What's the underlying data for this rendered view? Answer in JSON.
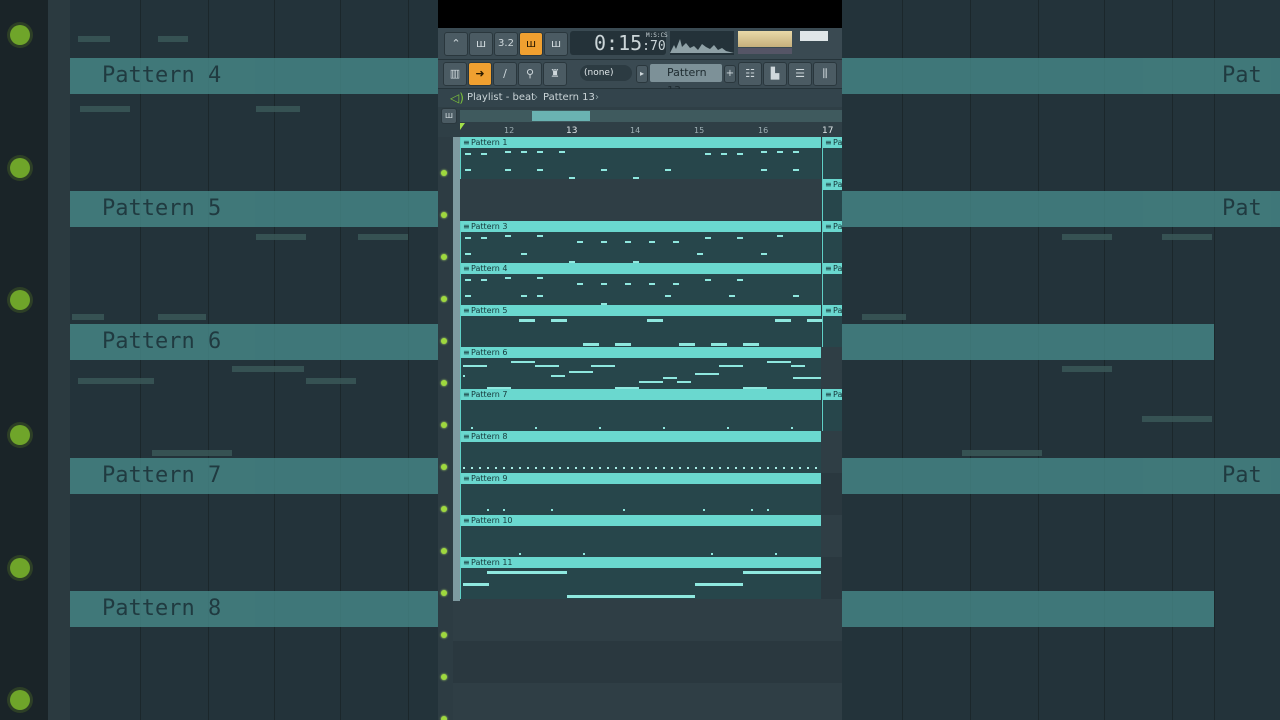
{
  "toolbar": {
    "time_main": "0:15",
    "time_ms": ":70",
    "time_format": "M:S:CS",
    "tempo": "3.2",
    "pattern_dropdown": "(none)",
    "pattern_selected": "Pattern 13",
    "accent": "#f0a030"
  },
  "breadcrumb": {
    "playlist": "Playlist - beat",
    "sep1": "›",
    "pattern": "Pattern 13",
    "sep2": "›"
  },
  "ruler": {
    "bars": [
      "12",
      "13",
      "14",
      "15",
      "16",
      "17"
    ]
  },
  "tracks": [
    {
      "clip": "Pattern 1"
    },
    {
      "clip": "Pa"
    },
    {
      "clip": "Pattern 3"
    },
    {
      "clip": "Pattern 4"
    },
    {
      "clip": "Pattern 5"
    },
    {
      "clip": "Pattern 6"
    },
    {
      "clip": "Pattern 7"
    },
    {
      "clip": "Pattern 8"
    },
    {
      "clip": "Pattern 9"
    },
    {
      "clip": "Pattern 10"
    },
    {
      "clip": "Pattern 11"
    }
  ],
  "clip_right_labels": [
    "Pa",
    "Pa",
    "Pa",
    "Pa",
    "Pa",
    "Pa",
    "Pa"
  ],
  "background": {
    "left_patterns": [
      "Pattern 4",
      "Pattern 5",
      "Pattern 6",
      "Pattern 7",
      "Pattern 8"
    ],
    "right_patterns": [
      "Pat",
      "Pat",
      "Pat"
    ]
  }
}
